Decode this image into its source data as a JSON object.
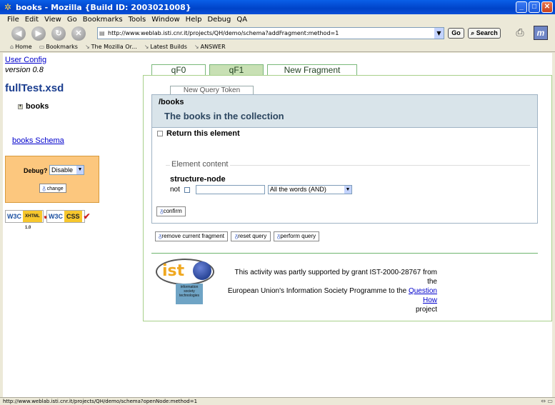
{
  "window": {
    "title": "books - Mozilla {Build ID: 2003021008}"
  },
  "menu": [
    "File",
    "Edit",
    "View",
    "Go",
    "Bookmarks",
    "Tools",
    "Window",
    "Help",
    "Debug",
    "QA"
  ],
  "navbar": {
    "url": "http://www.weblab.isti.cnr.it/projects/QH/demo/schema?addFragment:method=1",
    "go_label": "Go",
    "search_label": "Search"
  },
  "personal_toolbar": [
    "Home",
    "Bookmarks",
    "The Mozilla Or...",
    "Latest Builds",
    "ANSWER"
  ],
  "left": {
    "user_config": "User Config",
    "version": "version 0.8",
    "schema_file": "fullTest.xsd",
    "tree_root": "books",
    "schema_link": "books Schema",
    "debug_label": "Debug?",
    "debug_value": "Disable",
    "change_label": "change",
    "badges": [
      {
        "w3c": "W3C",
        "tag": "XHTML 1.0"
      },
      {
        "w3c": "W3C",
        "tag": "CSS"
      }
    ]
  },
  "tabs": [
    "qF0",
    "qF1",
    "New Fragment"
  ],
  "query": {
    "token_tab": "New Query Token",
    "path": "/books",
    "description": "The books in the collection",
    "return_label": "Return this element",
    "content_legend": "Element content",
    "node_name": "structure-node",
    "not_label": "not",
    "operator": "All the words (AND)",
    "confirm_label": "confirm"
  },
  "actions": {
    "remove": "remove current fragment",
    "reset": "reset query",
    "perform": "perform query"
  },
  "footer": {
    "logo_text": "ist",
    "logo_sub": "information society technologies",
    "ack_line1": "This activity was partly supported by grant IST-2000-28767 from the",
    "ack_line2": "European Union's Information Society Programme to the",
    "ack_link": "Question How",
    "ack_line3": "project"
  },
  "status": {
    "text": "http://www.weblab.isti.cnr.it/projects/QH/demo/schema?openNode:method=1"
  }
}
